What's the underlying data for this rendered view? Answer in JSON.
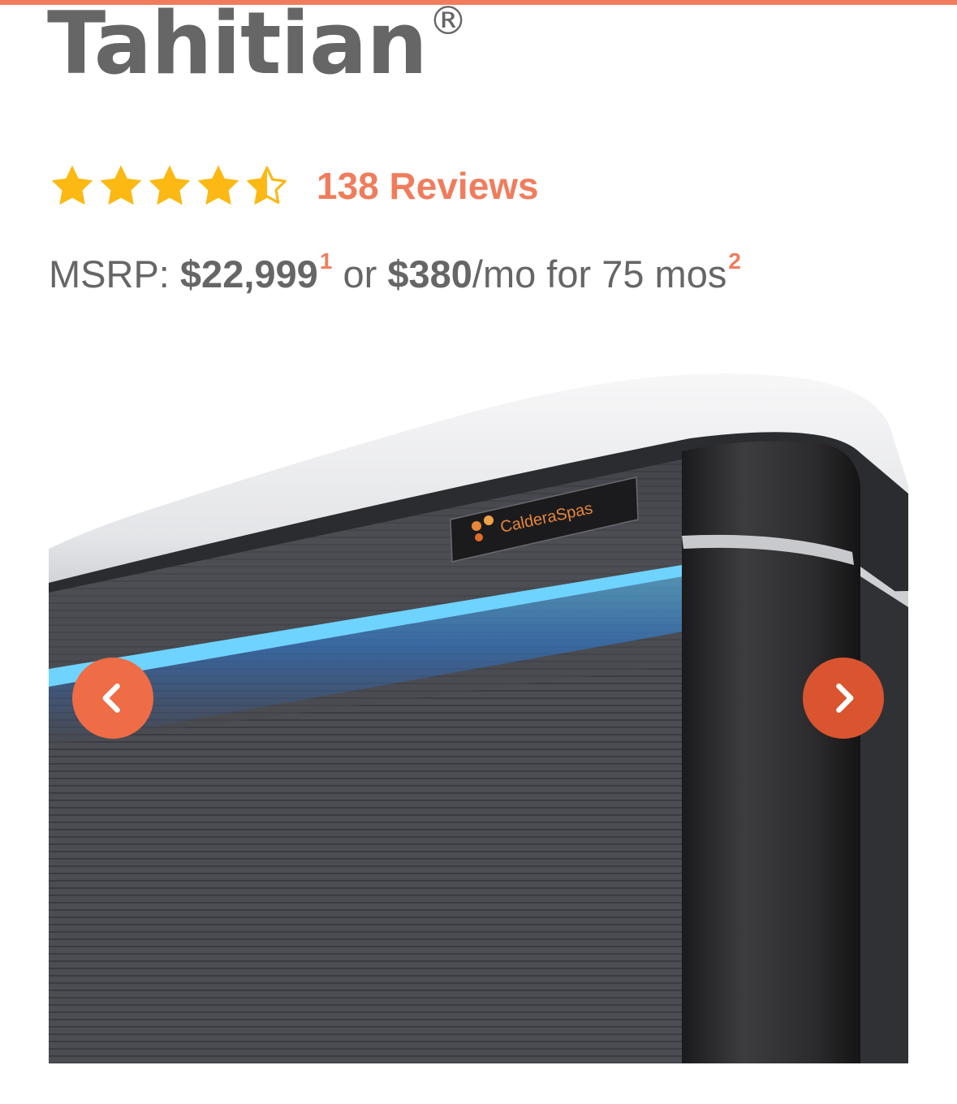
{
  "product": {
    "name": "Tahitian",
    "trademark": "®"
  },
  "rating": {
    "stars": 4.5,
    "max_stars": 5,
    "reviews_label": "138 Reviews",
    "star_color": "#fcb813"
  },
  "pricing": {
    "msrp_label": "MSRP: ",
    "msrp_value": "$22,999",
    "msrp_footnote": "1",
    "connector": " or ",
    "monthly_value": "$380",
    "monthly_suffix": "/mo for 75 mos",
    "monthly_footnote": "2"
  },
  "hero": {
    "brand_badge": "CalderaSpas",
    "prev_icon": "chevron-left-icon",
    "next_icon": "chevron-right-icon"
  },
  "colors": {
    "accent": "#ef7d5d",
    "text": "#666666"
  }
}
